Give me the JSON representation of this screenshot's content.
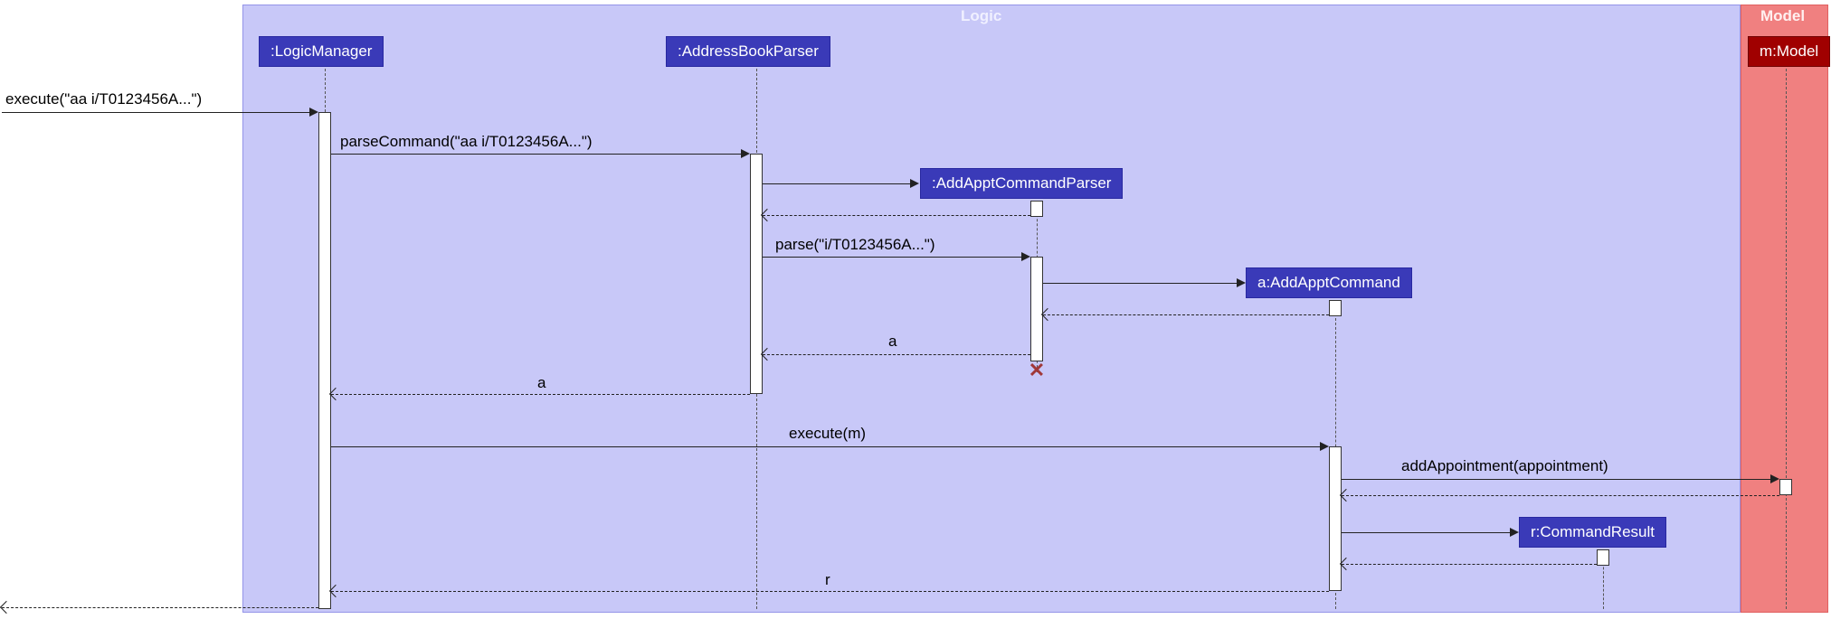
{
  "frames": {
    "logic": {
      "title": "Logic"
    },
    "model": {
      "title": "Model"
    }
  },
  "participants": {
    "logicManager": {
      "label": ":LogicManager"
    },
    "addressBookParser": {
      "label": ":AddressBookParser"
    },
    "addApptCommandParser": {
      "label": ":AddApptCommandParser"
    },
    "addApptCommand": {
      "label": "a:AddApptCommand"
    },
    "commandResult": {
      "label": "r:CommandResult"
    },
    "model": {
      "label": "m:Model"
    }
  },
  "messages": {
    "execute1": "execute(\"aa i/T0123456A...\")",
    "parseCommand": "parseCommand(\"aa i/T0123456A...\")",
    "parse": "parse(\"i/T0123456A...\")",
    "returnA1": "a",
    "returnA2": "a",
    "executeM": "execute(m)",
    "addAppointment": "addAppointment(appointment)",
    "returnR": "r"
  }
}
